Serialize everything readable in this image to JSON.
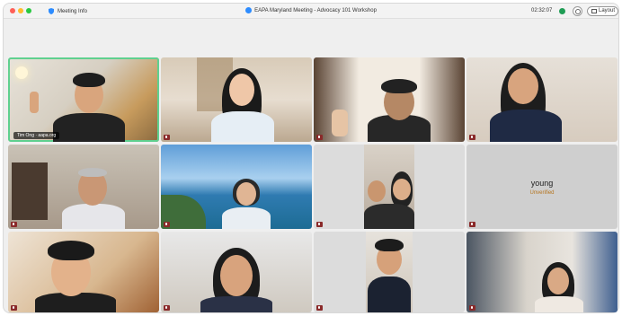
{
  "titlebar": {
    "meeting_info": "Meeting Info",
    "title": "EAPA Maryland Meeting - Advocacy 101 Workshop",
    "timer": "02:32:07",
    "layout_label": "Layout"
  },
  "tiles": [
    {
      "name_tag": "Tim Ong · aapa.org"
    },
    {
      "name_tag": ""
    },
    {
      "name_tag": ""
    },
    {
      "name_tag": ""
    },
    {
      "name_tag": ""
    },
    {
      "name_tag": ""
    },
    {
      "name_tag": ""
    },
    {
      "name_tag": ""
    },
    {
      "name_tag": ""
    },
    {
      "name_tag": ""
    },
    {
      "name_tag": ""
    },
    {
      "name_tag": ""
    }
  ],
  "avatar_tile": {
    "name": "young",
    "status": "Unverified"
  },
  "colors": {
    "active_speaker": "#5fd08f",
    "zoom_blue": "#2d8cff",
    "window_bg": "#efefef"
  }
}
